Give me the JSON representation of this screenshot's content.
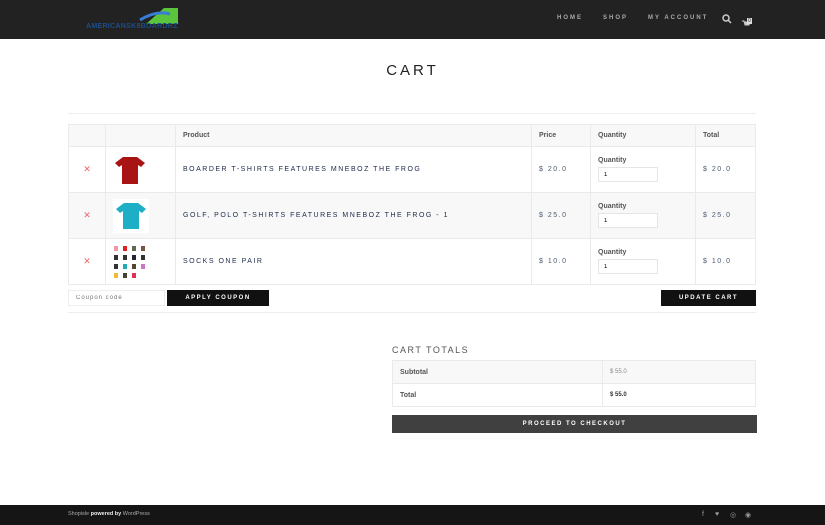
{
  "header": {
    "logo_text": "AMERICANSK8BOARDRZ",
    "nav": [
      "HOME",
      "SHOP",
      "MY ACCOUNT"
    ],
    "cart_count": "0"
  },
  "page_title": "CART",
  "table": {
    "headers": [
      "Product",
      "Price",
      "Quantity",
      "Total"
    ],
    "rows": [
      {
        "name": "BOARDER T-SHIRTS FEATURES MNEBOZ THE FROG",
        "price": "$ 20.0",
        "qty_label": "Quantity",
        "qty": "1",
        "total": "$ 20.0"
      },
      {
        "name": "GOLF, POLO T-SHIRTS FEATURES MNEBOZ THE FROG - 1",
        "price": "$ 25.0",
        "qty_label": "Quantity",
        "qty": "1",
        "total": "$ 25.0"
      },
      {
        "name": "SOCKS ONE PAIR",
        "price": "$ 10.0",
        "qty_label": "Quantity",
        "qty": "1",
        "total": "$ 10.0"
      }
    ]
  },
  "coupon": {
    "placeholder": "Coupon code",
    "apply": "APPLY COUPON",
    "update": "UPDATE CART"
  },
  "totals": {
    "heading": "CART TOTALS",
    "subtotal_label": "Subtotal",
    "subtotal": "$ 55.0",
    "total_label": "Total",
    "total": "$ 55.0",
    "checkout": "PROCEED TO CHECKOUT"
  },
  "footer": {
    "brand": "Shopisle",
    "powered": " powered by ",
    "wp": "WordPress"
  }
}
